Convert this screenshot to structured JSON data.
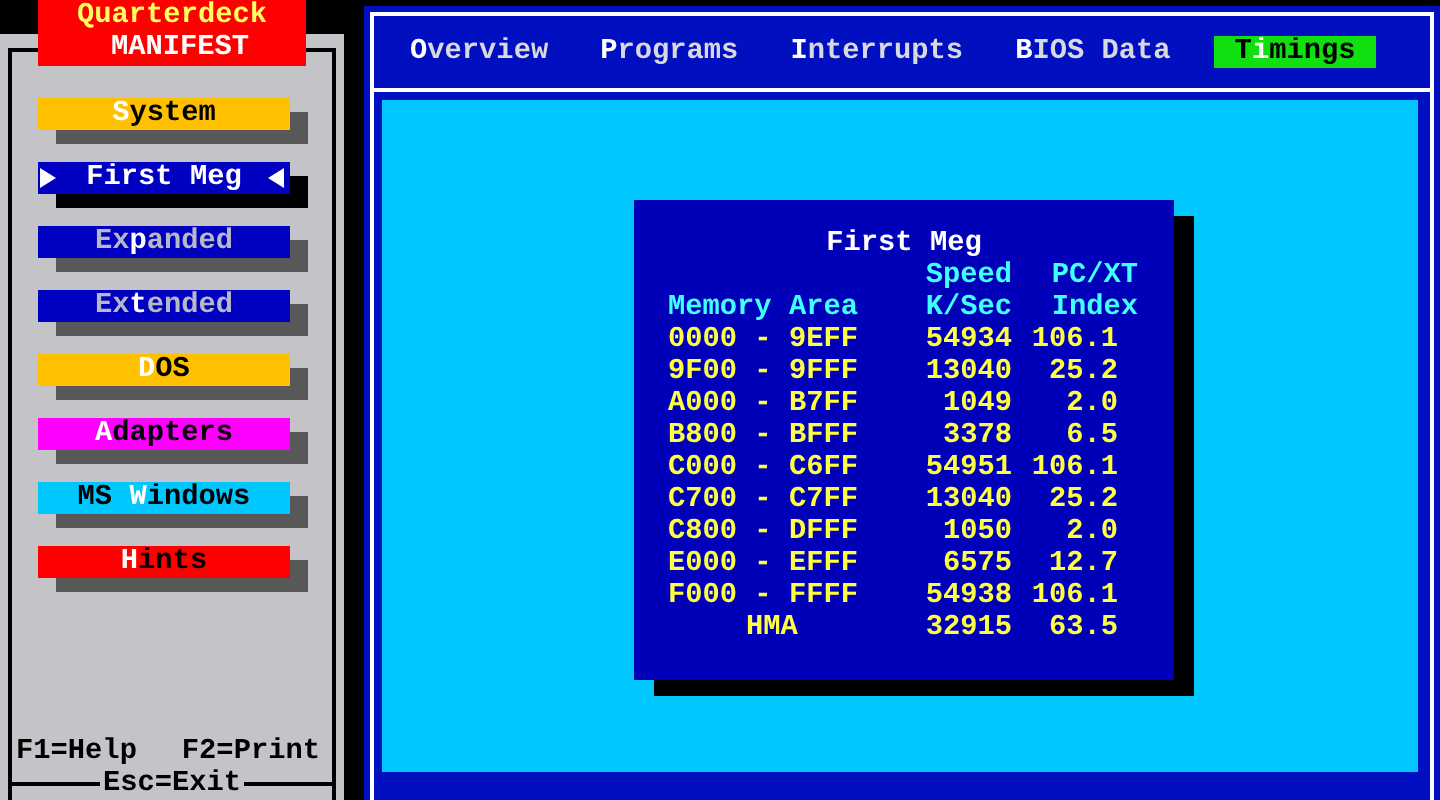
{
  "title": [
    "Quarterdeck",
    "MANIFEST"
  ],
  "menu": [
    {
      "hotkey": "S",
      "after": "ystem",
      "color": "#ffc000",
      "selected": false
    },
    {
      "hotkey": "F",
      "after": "irst Meg",
      "color": "#0000c0",
      "selected": true
    },
    {
      "before": "Ex",
      "hotkey": "p",
      "after": "anded",
      "color": "#0000c0",
      "selected": false
    },
    {
      "before": "Ex",
      "hotkey": "t",
      "after": "ended",
      "color": "#0000c0",
      "selected": false
    },
    {
      "hotkey": "D",
      "after": "OS",
      "color": "#ffc000",
      "selected": false
    },
    {
      "hotkey": "A",
      "after": "dapters",
      "color": "#ff00ff",
      "selected": false
    },
    {
      "before": "MS ",
      "hotkey": "W",
      "after": "indows",
      "color": "#00c8ff",
      "selected": false
    },
    {
      "hotkey": "H",
      "after": "ints",
      "color": "#ff0000",
      "selected": false
    }
  ],
  "footer": {
    "keys": [
      "F1=Help",
      "F2=Print"
    ],
    "exit": "Esc=Exit"
  },
  "tabs": [
    {
      "hotkey": "O",
      "after": "verview",
      "selected": false
    },
    {
      "hotkey": "P",
      "after": "rograms",
      "selected": false
    },
    {
      "hotkey": "I",
      "after": "nterrupts",
      "selected": false
    },
    {
      "hotkey": "B",
      "after": "IOS Data",
      "selected": false
    },
    {
      "before": "T",
      "hotkey": "i",
      "after": "mings",
      "selected": true
    }
  ],
  "dialog": {
    "title": "First Meg",
    "columns": [
      {
        "label": [
          "Memory Area"
        ]
      },
      {
        "label": [
          "Speed",
          "K/Sec"
        ]
      },
      {
        "label": [
          "PC/XT",
          "Index"
        ]
      }
    ],
    "rows": [
      {
        "kind": "range",
        "area": "0000 - 9EFF",
        "speed": "54934",
        "index": "106.1"
      },
      {
        "kind": "range",
        "area": "9F00 - 9FFF",
        "speed": "13040",
        "index": "25.2"
      },
      {
        "kind": "range",
        "area": "A000 - B7FF",
        "speed": "1049",
        "index": "2.0"
      },
      {
        "kind": "range",
        "area": "B800 - BFFF",
        "speed": "3378",
        "index": "6.5"
      },
      {
        "kind": "range",
        "area": "C000 - C6FF",
        "speed": "54951",
        "index": "106.1"
      },
      {
        "kind": "range",
        "area": "C700 - C7FF",
        "speed": "13040",
        "index": "25.2"
      },
      {
        "kind": "range",
        "area": "C800 - DFFF",
        "speed": "1050",
        "index": "2.0"
      },
      {
        "kind": "range",
        "area": "E000 - EFFF",
        "speed": "6575",
        "index": "12.7"
      },
      {
        "kind": "range",
        "area": "F000 - FFFF",
        "speed": "54938",
        "index": "106.1"
      },
      {
        "kind": "summary",
        "area": "HMA",
        "speed": "32915",
        "index": "63.5"
      }
    ]
  }
}
